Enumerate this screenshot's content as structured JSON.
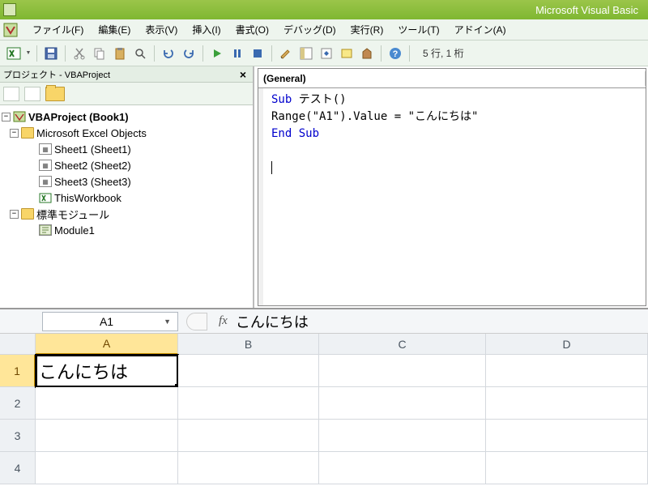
{
  "title": "Microsoft Visual Basic",
  "menus": {
    "file": "ファイル(F)",
    "edit": "編集(E)",
    "view": "表示(V)",
    "insert": "挿入(I)",
    "format": "書式(O)",
    "debug": "デバッグ(D)",
    "run": "実行(R)",
    "tools": "ツール(T)",
    "addins": "アドイン(A)"
  },
  "position": "5 行, 1 桁",
  "project_pane": {
    "title": "プロジェクト - VBAProject",
    "root": "VBAProject (Book1)",
    "folder_objects": "Microsoft Excel Objects",
    "sheet1": "Sheet1 (Sheet1)",
    "sheet2": "Sheet2 (Sheet2)",
    "sheet3": "Sheet3 (Sheet3)",
    "thiswb": "ThisWorkbook",
    "folder_modules": "標準モジュール",
    "module1": "Module1"
  },
  "code": {
    "dropdown": "(General)",
    "line1a": "Sub",
    "line1b": " テスト()",
    "line2": "  Range(\"A1\").Value = \"こんにちは\"",
    "line3": "End Sub"
  },
  "excel": {
    "namebox": "A1",
    "fx": "fx",
    "formula": "こんにちは",
    "cols": [
      "A",
      "B",
      "C",
      "D"
    ],
    "rows": [
      "1",
      "2",
      "3",
      "4"
    ],
    "a1": "こんにちは"
  }
}
